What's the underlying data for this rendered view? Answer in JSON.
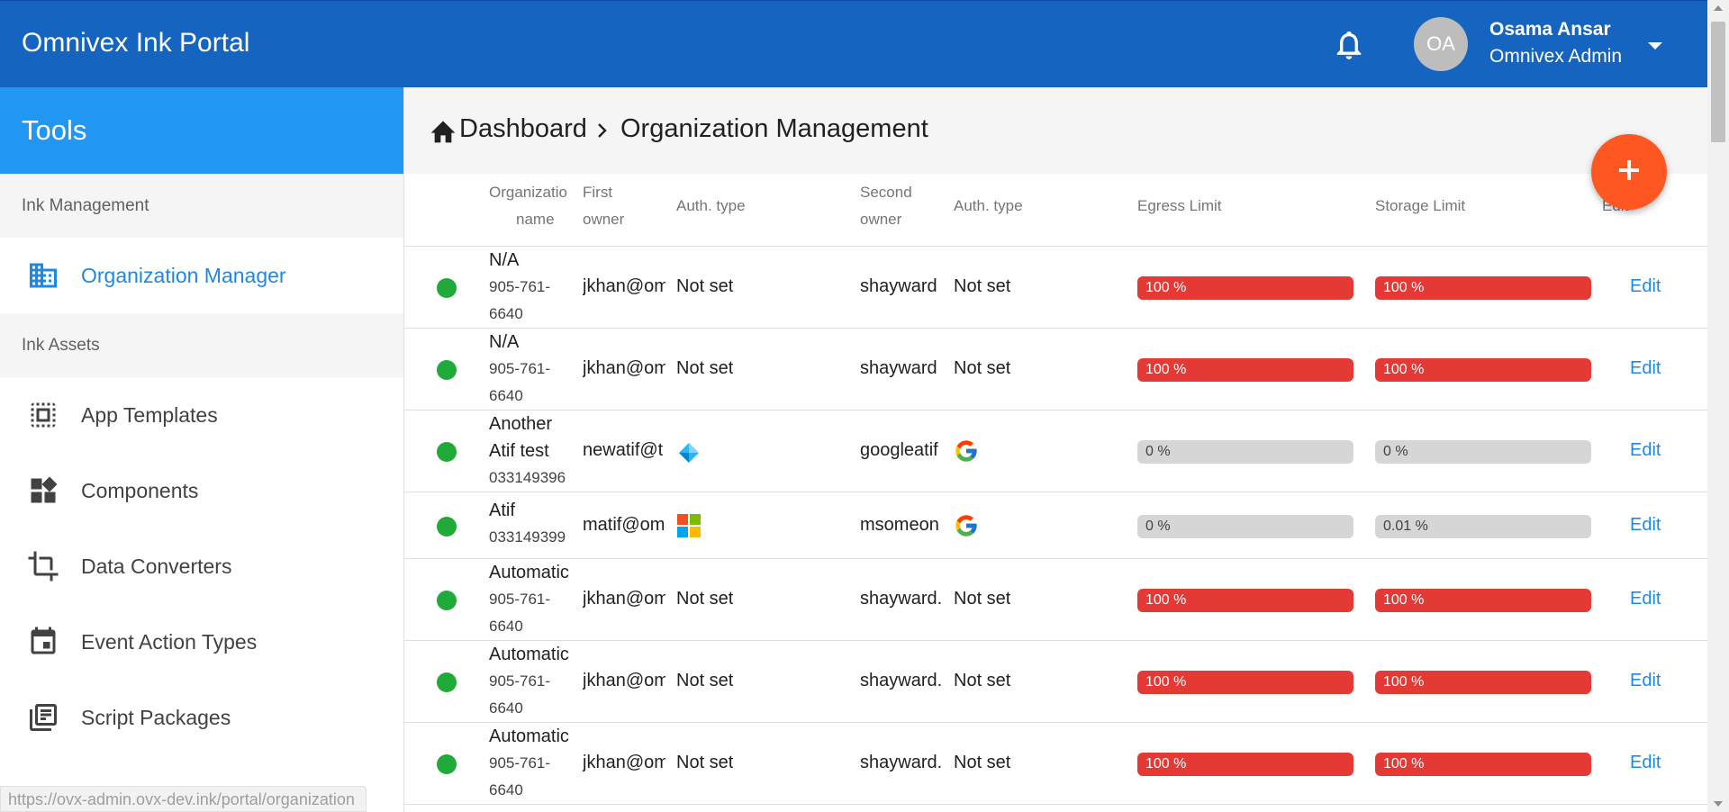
{
  "app": {
    "title": "Omnivex Ink Portal"
  },
  "user": {
    "initials": "OA",
    "name": "Osama Ansar",
    "role": "Omnivex Admin"
  },
  "sidebar": {
    "header": "Tools",
    "sections": [
      {
        "label": "Ink Management",
        "items": [
          {
            "label": "Organization Manager",
            "icon": "business-icon",
            "active": true
          }
        ]
      },
      {
        "label": "Ink Assets",
        "items": [
          {
            "label": "App Templates",
            "icon": "template-icon"
          },
          {
            "label": "Components",
            "icon": "widgets-icon"
          },
          {
            "label": "Data Converters",
            "icon": "crop-icon"
          },
          {
            "label": "Event Action Types",
            "icon": "calendar-icon"
          },
          {
            "label": "Script Packages",
            "icon": "library-icon"
          }
        ]
      }
    ]
  },
  "status_url": "https://ovx-admin.ovx-dev.ink/portal/organization",
  "breadcrumb": {
    "home": "Dashboard",
    "current": "Organization Management"
  },
  "table": {
    "headers": {
      "org_line1": "Organizatio",
      "org_line2": "name",
      "first_owner_line1": "First",
      "first_owner_line2": "owner",
      "auth_type_1": "Auth. type",
      "second_owner_line1": "Second",
      "second_owner_line2": "owner",
      "auth_type_2": "Auth. type",
      "egress": "Egress Limit",
      "storage": "Storage Limit",
      "edit": "Edit"
    },
    "edit_label": "Edit",
    "rows": [
      {
        "name": "N/A",
        "phone1": "905-761-",
        "phone2": "6640",
        "first_owner": "jkhan@om",
        "auth1": "Not set",
        "second_owner": "shayward",
        "auth2": "Not set",
        "egress": "100 %",
        "storage": "100 %"
      },
      {
        "name": "N/A",
        "phone1": "905-761-",
        "phone2": "6640",
        "first_owner": "jkhan@om",
        "auth1": "Not set",
        "second_owner": "shayward",
        "auth2": "Not set",
        "egress": "100 %",
        "storage": "100 %"
      },
      {
        "name": "Another",
        "name2": "Atif test",
        "phone1": "033149396",
        "first_owner": "newatif@t",
        "auth1_icon": "azure-icon",
        "second_owner": "googleatif",
        "auth2_icon": "google-icon",
        "egress": "0 %",
        "storage": "0 %"
      },
      {
        "name": "Atif",
        "phone1": "033149399",
        "first_owner": "matif@om",
        "auth1_icon": "microsoft-icon",
        "second_owner": "msomeon",
        "auth2_icon": "google-icon",
        "egress": "0 %",
        "storage": "0.01 %"
      },
      {
        "name": "Automatic",
        "phone1": "905-761-",
        "phone2": "6640",
        "first_owner": "jkhan@om",
        "auth1": "Not set",
        "second_owner": "shayward.",
        "auth2": "Not set",
        "egress": "100 %",
        "storage": "100 %"
      },
      {
        "name": "Automatic",
        "phone1": "905-761-",
        "phone2": "6640",
        "first_owner": "jkhan@om",
        "auth1": "Not set",
        "second_owner": "shayward.",
        "auth2": "Not set",
        "egress": "100 %",
        "storage": "100 %"
      },
      {
        "name": "Automatic",
        "phone1": "905-761-",
        "phone2": "6640",
        "first_owner": "jkhan@om",
        "auth1": "Not set",
        "second_owner": "shayward.",
        "auth2": "Not set",
        "egress": "100 %",
        "storage": "100 %"
      }
    ]
  },
  "colors": {
    "appbar": "#1565c0",
    "tools_header": "#2196f3",
    "accent": "#1e88e5",
    "fab": "#ff5722",
    "limit_full": "#e53935",
    "status_dot": "#1faa3a"
  }
}
